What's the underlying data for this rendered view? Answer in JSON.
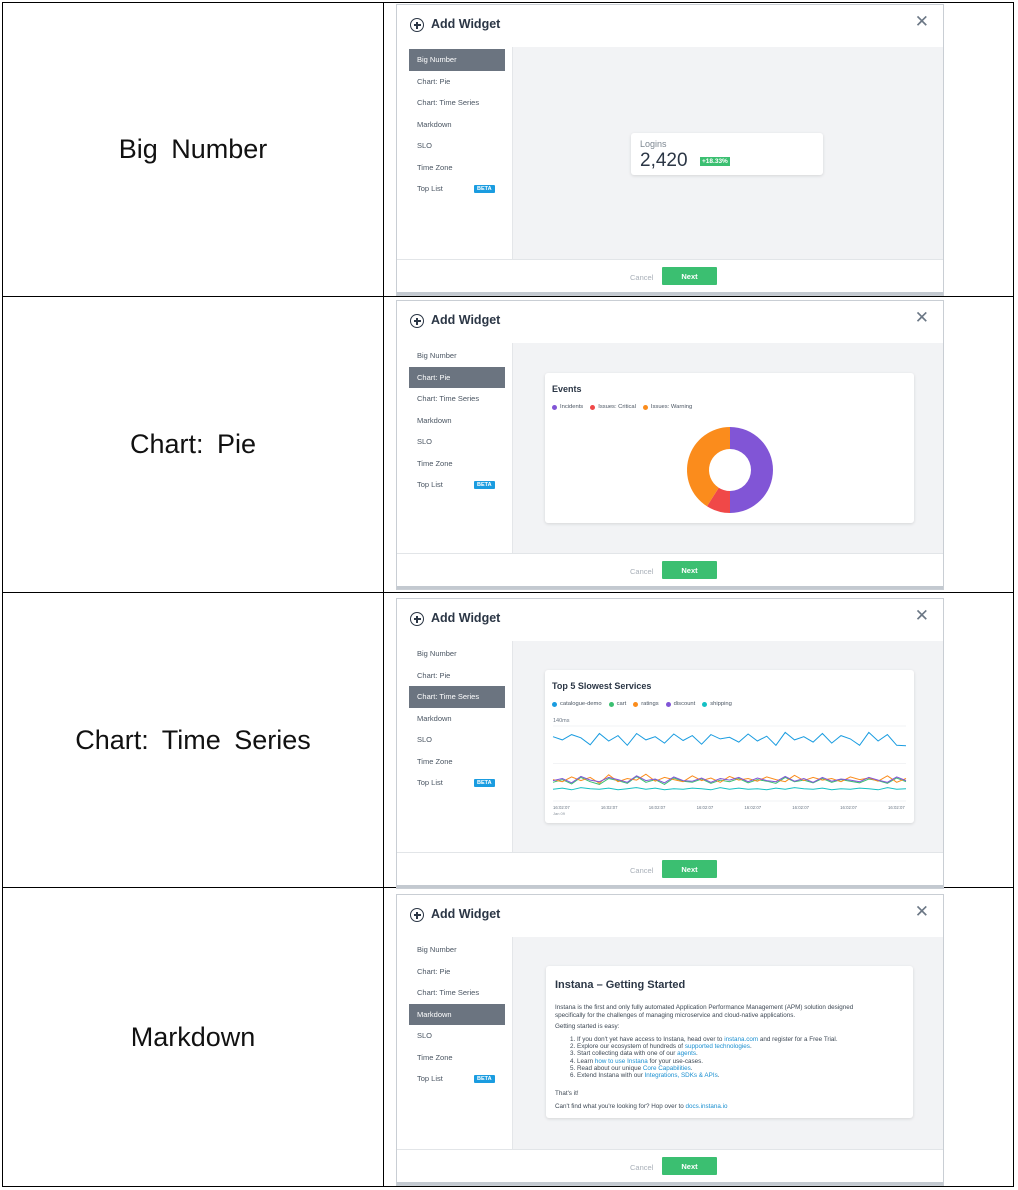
{
  "rows": [
    {
      "label": "Big Number",
      "active_index": 0
    },
    {
      "label": "Chart: Pie",
      "active_index": 1
    },
    {
      "label": "Chart: Time Series",
      "active_index": 2
    },
    {
      "label": "Markdown",
      "active_index": 3
    }
  ],
  "modal": {
    "title": "Add Widget",
    "close_glyph": "✕",
    "nav_items": [
      "Big Number",
      "Chart: Pie",
      "Chart: Time Series",
      "Markdown",
      "SLO",
      "Time Zone",
      "Top List"
    ],
    "beta_badge": "BETA",
    "cancel_label": "Cancel",
    "next_label": "Next"
  },
  "big_number": {
    "label": "Logins",
    "value": "2,420",
    "change": "+18.33%"
  },
  "pie": {
    "title": "Events",
    "legend": [
      {
        "name": "Incidents",
        "color": "#8155d6"
      },
      {
        "name": "Issues: Critical",
        "color": "#f04848"
      },
      {
        "name": "Issues: Warning",
        "color": "#fb8c1c"
      }
    ]
  },
  "timeseries": {
    "title": "Top 5 Slowest Services",
    "legend": [
      {
        "name": "catalogue-demo",
        "color": "#1a9ce0"
      },
      {
        "name": "cart",
        "color": "#3bbf71"
      },
      {
        "name": "ratings",
        "color": "#fb8c1c"
      },
      {
        "name": "discount",
        "color": "#8155d6"
      },
      {
        "name": "shipping",
        "color": "#15c0c4"
      }
    ],
    "y_label": "140ms",
    "x_ticks": [
      "16:02:07",
      "16:02:07",
      "16:02:07",
      "16:02:07",
      "16:02:07",
      "16:02:07",
      "16:02:07",
      "16:02:07"
    ],
    "x_date": "Jan 09"
  },
  "markdown": {
    "title": "Instana – Getting Started",
    "intro_1": "Instana is the first and only fully automated Application Performance Management (APM) solution designed",
    "intro_2": "specifically for the challenges of managing microservice and cloud-native applications.",
    "getting_started": "Getting started is easy:",
    "list": [
      {
        "pre": "1. If you don't yet have access to Instana, head over to ",
        "link": "instana.com",
        "post": " and register for a Free Trial."
      },
      {
        "pre": "2. Explore our ecosystem of hundreds of ",
        "link": "supported technologies",
        "post": "."
      },
      {
        "pre": "3. Start collecting data with one of our ",
        "link": "agents",
        "post": "."
      },
      {
        "pre": "4. Learn ",
        "link": "how to use Instana",
        "post": " for your use-cases."
      },
      {
        "pre": "5. Read about our unique ",
        "link": "Core Capabilities",
        "post": "."
      },
      {
        "pre": "6. Extend Instana with our ",
        "link": "Integrations, SDKs & APIs",
        "post": "."
      }
    ],
    "thats_it": "That's it!",
    "cant_find": "Can't find what you're looking for? Hop over to ",
    "docs_link": "docs.instana.io"
  },
  "chart_data": [
    {
      "type": "pie",
      "title": "Events",
      "categories": [
        "Incidents",
        "Issues: Critical",
        "Issues: Warning"
      ],
      "values": [
        50,
        9,
        41
      ],
      "donut": true
    },
    {
      "type": "line",
      "title": "Top 5 Slowest Services",
      "ylabel": "",
      "y_tick": "140ms",
      "x_ticks": [
        "16:02:07",
        "16:02:07",
        "16:02:07",
        "16:02:07",
        "16:02:07",
        "16:02:07",
        "16:02:07",
        "16:02:07"
      ],
      "series": [
        {
          "name": "catalogue-demo",
          "values": [
            120,
            114,
            124,
            118,
            105,
            126,
            112,
            122,
            104,
            126,
            114,
            120,
            108,
            125,
            113,
            122,
            106,
            124,
            116,
            119,
            110,
            125,
            112,
            121,
            104,
            128,
            114,
            120,
            110,
            126,
            108,
            122,
            116,
            104,
            128,
            112,
            124,
            104,
            103
          ]
        },
        {
          "name": "cart",
          "values": [
            35,
            40,
            32,
            44,
            36,
            31,
            42,
            38,
            33,
            46,
            35,
            40,
            31,
            43,
            37,
            35,
            41,
            33,
            39,
            36,
            42,
            34,
            40,
            37,
            33,
            44,
            36,
            39,
            34,
            42,
            35,
            40,
            37,
            34,
            41,
            38,
            33,
            43,
            36
          ]
        },
        {
          "name": "ratings",
          "values": [
            40,
            36,
            45,
            38,
            44,
            33,
            49,
            36,
            42,
            39,
            50,
            37,
            44,
            40,
            36,
            47,
            38,
            43,
            35,
            46,
            39,
            42,
            37,
            45,
            40,
            36,
            48,
            38,
            44,
            39,
            42,
            36,
            45,
            40,
            43,
            37,
            47,
            35,
            42
          ]
        },
        {
          "name": "discount",
          "values": [
            38,
            42,
            34,
            46,
            39,
            36,
            44,
            40,
            35,
            47,
            38,
            41,
            34,
            45,
            38,
            37,
            43,
            35,
            42,
            39,
            44,
            36,
            43,
            38,
            36,
            46,
            37,
            42,
            35,
            44,
            37,
            41,
            39,
            36,
            44,
            39,
            35,
            45,
            38
          ]
        },
        {
          "name": "shipping",
          "values": [
            22,
            24,
            21,
            25,
            23,
            22,
            24,
            21,
            23,
            25,
            22,
            24,
            21,
            23,
            22,
            24,
            23,
            21,
            25,
            22,
            24,
            22,
            23,
            21,
            24,
            22,
            25,
            23,
            22,
            24,
            21,
            23,
            22,
            24,
            23,
            21,
            25,
            22,
            23
          ]
        }
      ]
    }
  ]
}
